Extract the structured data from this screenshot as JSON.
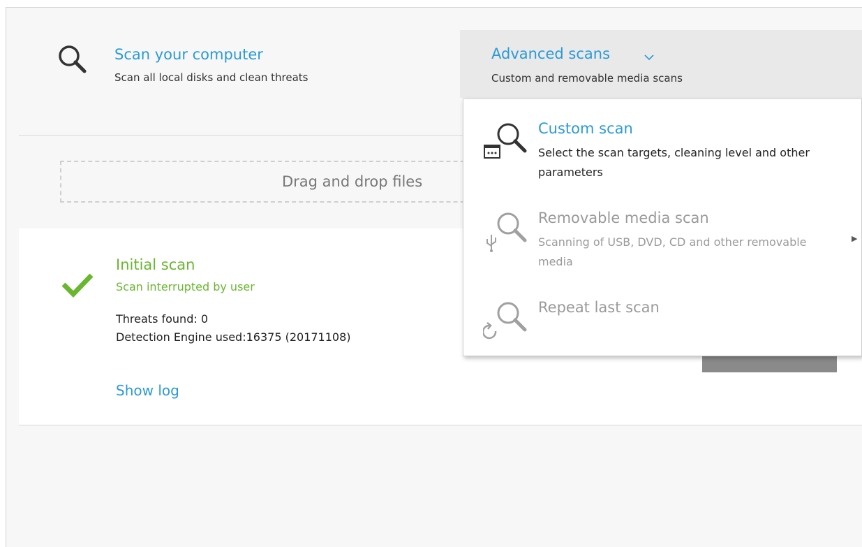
{
  "scan_computer": {
    "title": "Scan your computer",
    "subtitle": "Scan all local disks and clean threats",
    "icon": "search-icon"
  },
  "advanced_scans": {
    "title": "Advanced scans",
    "subtitle": "Custom and removable media scans",
    "icon": "chevron-down-icon"
  },
  "dropzone": {
    "label": "Drag and drop files"
  },
  "result": {
    "title": "Initial scan",
    "status": "Scan interrupted by user",
    "threats": "Threats found: 0",
    "engine": "Detection Engine used:16375 (20171108)",
    "show_log": "Show log",
    "status_color": "#68b72f"
  },
  "menu": {
    "items": [
      {
        "title": "Custom scan",
        "desc": "Select the scan targets, cleaning level and other parameters",
        "icon": "custom-scan-icon"
      },
      {
        "title": "Removable media scan",
        "desc": "Scanning of USB, DVD, CD and other removable media",
        "icon": "usb-scan-icon"
      },
      {
        "title": "Repeat last scan",
        "desc": "",
        "icon": "repeat-scan-icon"
      }
    ]
  },
  "colors": {
    "accent": "#2a9ad6",
    "success": "#68b72f",
    "disabled": "#9a9a9a"
  }
}
